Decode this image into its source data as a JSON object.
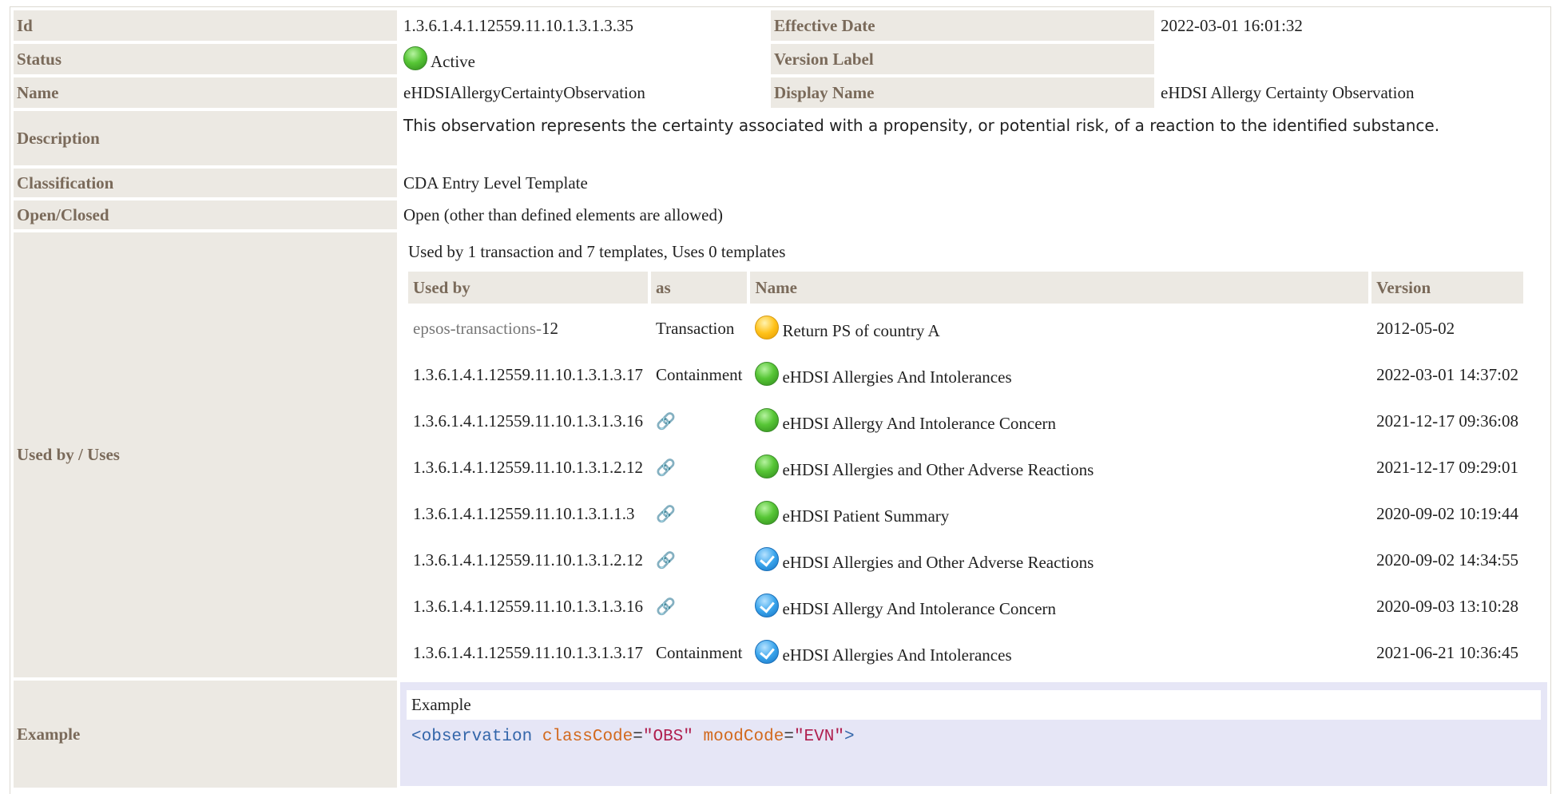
{
  "rows": {
    "id": {
      "label": "Id",
      "value": "1.3.6.1.4.1.12559.11.10.1.3.1.3.35"
    },
    "effective_date": {
      "label": "Effective Date",
      "value": "2022-03-01 16:01:32"
    },
    "status": {
      "label": "Status",
      "value": "Active",
      "icon": "green-status-icon"
    },
    "version_label": {
      "label": "Version Label",
      "value": ""
    },
    "name": {
      "label": "Name",
      "value": "eHDSIAllergyCertaintyObservation"
    },
    "display_name": {
      "label": "Display Name",
      "value": "eHDSI Allergy Certainty Observation"
    },
    "description": {
      "label": "Description",
      "value": "This observation represents the certainty associated with a propensity, or potential risk, of a reaction to the identified substance."
    },
    "classification": {
      "label": "Classification",
      "value": "CDA Entry Level Template"
    },
    "open_closed": {
      "label": "Open/Closed",
      "value": "Open (other than defined elements are allowed)"
    },
    "used_by": {
      "label": "Used by / Uses",
      "caption": "Used by 1 transaction and 7 templates, Uses 0 templates"
    },
    "example": {
      "label": "Example",
      "title": "Example"
    }
  },
  "uses_table": {
    "headers": [
      "Used by",
      "as",
      "Name",
      "Version"
    ],
    "rows": [
      {
        "prefix": "epsos-transactions-",
        "id": "12",
        "as": "Transaction",
        "status": "yellow",
        "name": "Return PS of country A",
        "version": "2012-05-02"
      },
      {
        "prefix": "",
        "id": "1.3.6.1.4.1.12559.11.10.1.3.1.3.17",
        "as": "Containment",
        "status": "green",
        "name": "eHDSI Allergies And Intolerances",
        "version": "2022-03-01 14:37:02"
      },
      {
        "prefix": "",
        "id": "1.3.6.1.4.1.12559.11.10.1.3.1.3.16",
        "as": "",
        "as_icon": "link-icon",
        "status": "green",
        "name": "eHDSI Allergy And Intolerance Concern",
        "version": "2021-12-17 09:36:08"
      },
      {
        "prefix": "",
        "id": "1.3.6.1.4.1.12559.11.10.1.3.1.2.12",
        "as": "",
        "as_icon": "link-icon",
        "status": "green",
        "name": "eHDSI Allergies and Other Adverse Reactions",
        "version": "2021-12-17 09:29:01"
      },
      {
        "prefix": "",
        "id": "1.3.6.1.4.1.12559.11.10.1.3.1.1.3",
        "as": "",
        "as_icon": "link-icon",
        "status": "green",
        "name": "eHDSI Patient Summary",
        "version": "2020-09-02 10:19:44"
      },
      {
        "prefix": "",
        "id": "1.3.6.1.4.1.12559.11.10.1.3.1.2.12",
        "as": "",
        "as_icon": "link-icon",
        "status": "blue",
        "name": "eHDSI Allergies and Other Adverse Reactions",
        "version": "2020-09-02 14:34:55"
      },
      {
        "prefix": "",
        "id": "1.3.6.1.4.1.12559.11.10.1.3.1.3.16",
        "as": "",
        "as_icon": "link-icon",
        "status": "blue",
        "name": "eHDSI Allergy And Intolerance Concern",
        "version": "2020-09-03 13:10:28"
      },
      {
        "prefix": "",
        "id": "1.3.6.1.4.1.12559.11.10.1.3.1.3.17",
        "as": "Containment",
        "status": "blue",
        "name": "eHDSI Allergies And Intolerances",
        "version": "2021-06-21 10:36:45"
      }
    ]
  },
  "example_code": {
    "open": "<",
    "tag": "observation",
    "attr1": "classCode",
    "eq1": "=",
    "val1": "\"OBS\"",
    "attr2": "moodCode",
    "eq2": "=",
    "val2": "\"EVN\"",
    "close": ">"
  },
  "colors": {
    "label_bg": "#ece9e3",
    "label_text": "#7a6a5a",
    "example_bg": "#e6e6f6",
    "link_icon": "#e07a2a"
  }
}
